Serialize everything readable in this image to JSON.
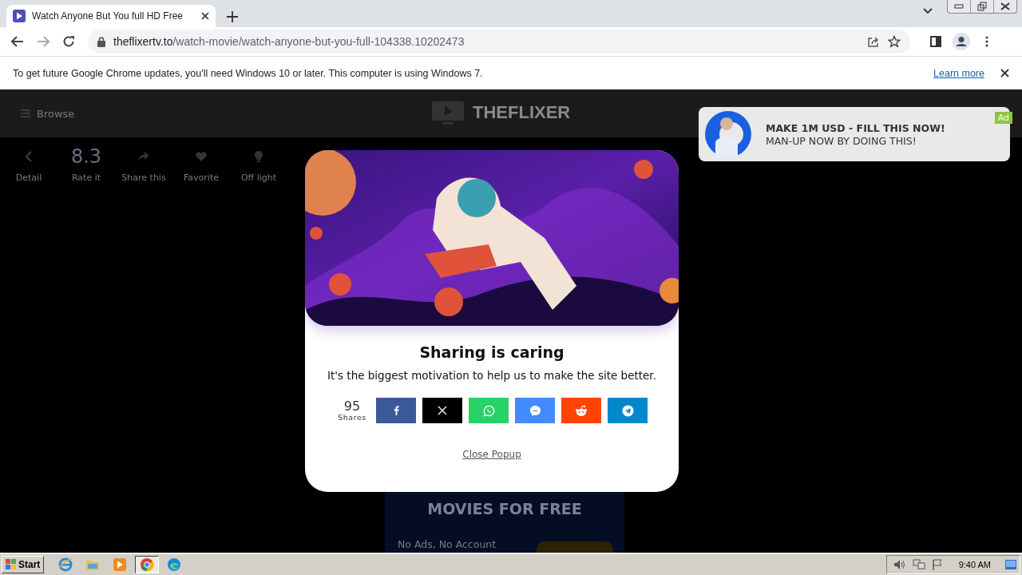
{
  "browser": {
    "tab": {
      "title": "Watch Anyone But You full HD Free"
    },
    "url": {
      "domain": "theflixertv.to",
      "path": "/watch-movie/watch-anyone-but-you-full-104338.10202473"
    },
    "infobar": {
      "message": "To get future Google Chrome updates, you'll need Windows 10 or later. This computer is using Windows 7.",
      "link": "Learn more"
    }
  },
  "site": {
    "nav": {
      "browse": "Browse",
      "logo": "THEFLIXER"
    },
    "actions": [
      {
        "kind": "icon",
        "label": "Detail"
      },
      {
        "kind": "rating",
        "value": "8.3",
        "label": "Rate it"
      },
      {
        "kind": "icon",
        "label": "Share this"
      },
      {
        "kind": "icon",
        "label": "Favorite"
      },
      {
        "kind": "icon",
        "label": "Off light"
      }
    ],
    "banner": {
      "title": "MOVIES FOR FREE",
      "subtitle": "No Ads, No Account"
    }
  },
  "modal": {
    "title": "Sharing is caring",
    "text": "It's the biggest motivation to help us to make the site better.",
    "count": "95",
    "count_label": "Shares",
    "share_buttons": [
      {
        "color": "#3b5998"
      },
      {
        "color": "#000000"
      },
      {
        "color": "#25d366"
      },
      {
        "color": "#448aff"
      },
      {
        "color": "#ff4500"
      },
      {
        "color": "#0088cc"
      }
    ],
    "close": "Close Popup"
  },
  "ad": {
    "headline": "MAKE 1M USD - FILL THIS NOW!",
    "subline": "MAN-UP NOW BY DOING THIS!",
    "badge": "Ad"
  },
  "taskbar": {
    "start": "Start",
    "apps": [
      {
        "selected": false
      },
      {
        "selected": false
      },
      {
        "selected": false
      },
      {
        "selected": true
      },
      {
        "selected": false
      }
    ],
    "clock": "9:40 AM"
  }
}
